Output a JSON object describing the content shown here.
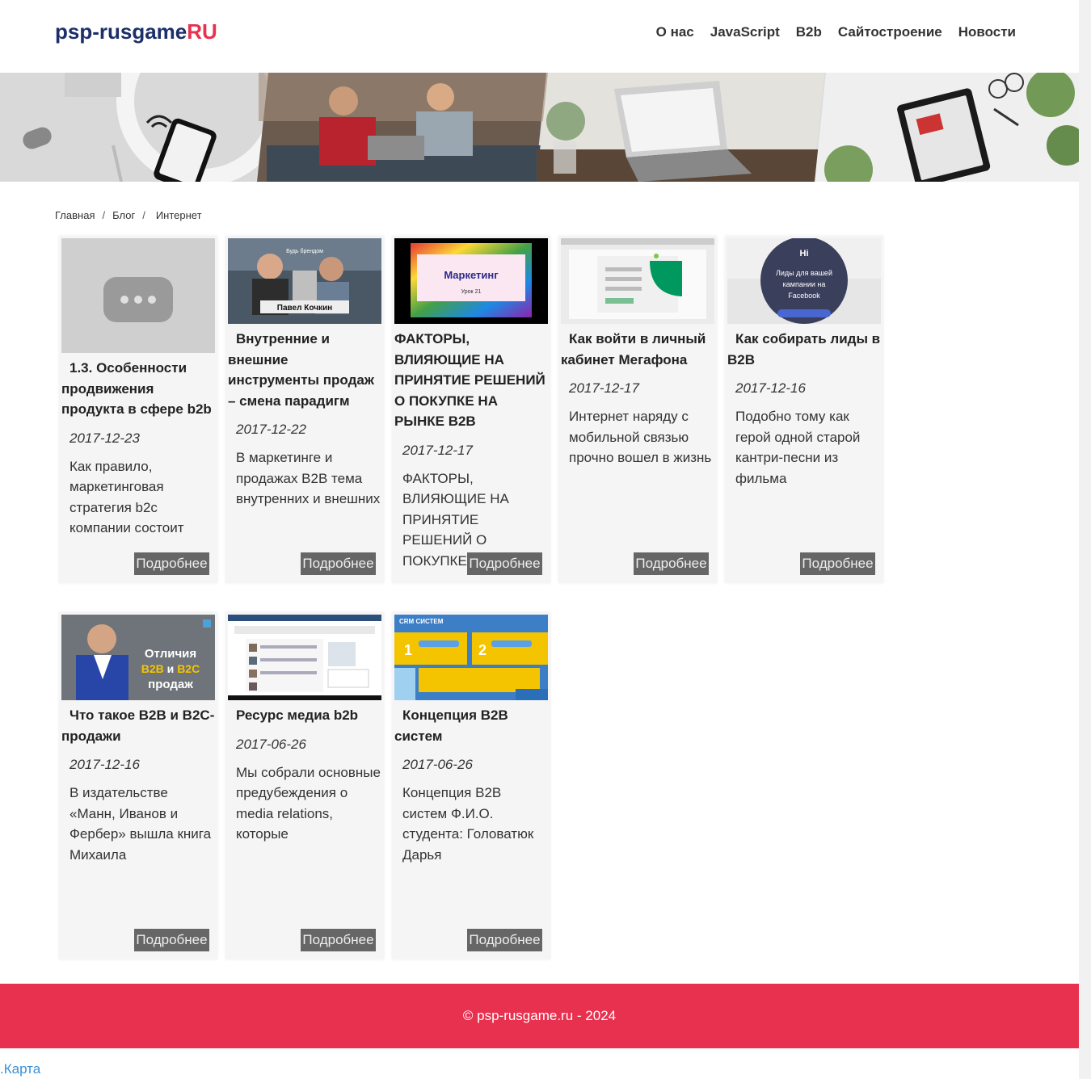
{
  "header": {
    "logo_main": "psp-rusgame",
    "logo_suffix": "RU",
    "nav": [
      "О нас",
      "JavaScript",
      "B2b",
      "Сайтостроение",
      "Новости"
    ]
  },
  "breadcrumb": [
    "Главная",
    "Блог",
    "Интернет"
  ],
  "cards": [
    {
      "title": "1.3. Особенности продвижения продукта в сфере b2b",
      "date": "2017-12-23",
      "excerpt": "Как правило, маркетинговая стратегия b2c компании состоит",
      "more": "Подробнее"
    },
    {
      "title": "Внутренние и внешние инструменты продаж – смена парадигм",
      "date": "2017-12-22",
      "excerpt": "В маркетинге и продажах B2B тема внутренних и внешних",
      "more": "Подробнее",
      "thumb_text": "Павел Кочкин",
      "thumb_caption": "Будь брендом"
    },
    {
      "title": "ФАКТОРЫ, ВЛИЯЮЩИЕ НА ПРИНЯТИЕ РЕШЕНИЙ О ПОКУПКЕ НА РЫНКЕ В2В",
      "date": "2017-12-17",
      "excerpt": "ФАКТОРЫ, ВЛИЯЮЩИЕ НА ПРИНЯТИЕ РЕШЕНИЙ О ПОКУПКЕ НА РЫНКЕ",
      "more": "Подробнее",
      "thumb_title": "Маркетинг",
      "thumb_sub": "Урок 21"
    },
    {
      "title": "Как войти в личный кабинет Мегафона",
      "date": "2017-12-17",
      "excerpt": "Интернет наряду с мобильной связью прочно вошел в жизнь",
      "more": "Подробнее"
    },
    {
      "title": "Как собирать лиды в B2B",
      "date": "2017-12-16",
      "excerpt": "Подобно тому как герой одной старой кантри-песни из фильма",
      "more": "Подробнее",
      "thumb_logo": "Hi",
      "thumb_line1": "Лиды для вашей",
      "thumb_line2": "кампании на",
      "thumb_line3": "Facebook"
    },
    {
      "title": "Что такое B2B и B2C-продажи",
      "date": "2017-12-16",
      "excerpt": "В издательстве «Манн, Иванов и Фербер» вышла книга Михаила",
      "more": "Подробнее",
      "thumb_l1": "Отличия",
      "thumb_b2b": "B2B",
      "thumb_and": " и ",
      "thumb_b2c": "B2C",
      "thumb_l3": "продаж"
    },
    {
      "title": "Ресурс медиа b2b",
      "date": "2017-06-26",
      "excerpt": "Мы собрали основные предубеждения о media relations, которые",
      "more": "Подробнее"
    },
    {
      "title": "Концепция B2B систем",
      "date": "2017-06-26",
      "excerpt": "Концепция B2B систем Ф.И.О. студента: Головатюк Дарья",
      "more": "Подробнее",
      "thumb_head": "CRM СИСТЕМ",
      "thumb_n1": "1",
      "thumb_n2": "2"
    }
  ],
  "footer": {
    "copyright": "© psp-rusgame.ru - 2024"
  },
  "map_link": ".Карта"
}
